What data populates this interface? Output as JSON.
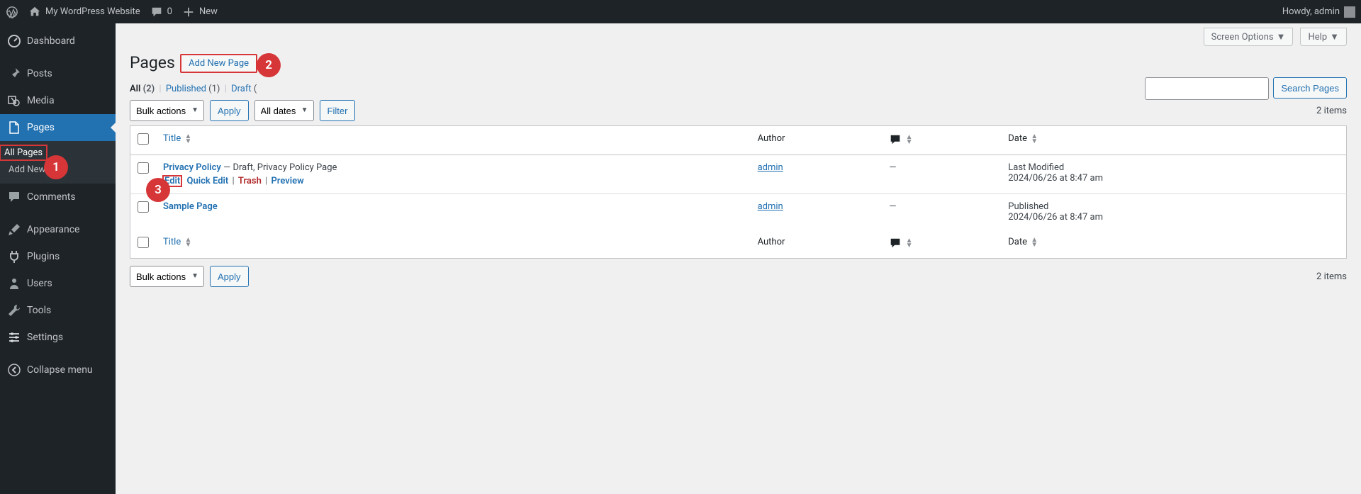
{
  "adminbar": {
    "site_name": "My WordPress Website",
    "comments_count": "0",
    "new_label": "New",
    "howdy": "Howdy, admin"
  },
  "sidebar": {
    "dashboard": "Dashboard",
    "posts": "Posts",
    "media": "Media",
    "pages": "Pages",
    "pages_sub_all": "All Pages",
    "pages_sub_add": "Add New",
    "comments": "Comments",
    "appearance": "Appearance",
    "plugins": "Plugins",
    "users": "Users",
    "tools": "Tools",
    "settings": "Settings",
    "collapse": "Collapse menu"
  },
  "screen_meta": {
    "screen_options": "Screen Options",
    "help": "Help"
  },
  "header": {
    "title": "Pages",
    "add_new": "Add New Page"
  },
  "filters": {
    "all_label": "All",
    "all_count": "(2)",
    "published_label": "Published",
    "published_count": "(1)",
    "draft_label": "Draft",
    "draft_count": "(",
    "bulk_actions": "Bulk actions",
    "apply": "Apply",
    "all_dates": "All dates",
    "filter": "Filter",
    "item_count": "2 items",
    "search_btn": "Search Pages"
  },
  "table": {
    "col_title": "Title",
    "col_author": "Author",
    "col_date": "Date",
    "rows": [
      {
        "title": "Privacy Policy",
        "state": " — Draft, Privacy Policy Page",
        "author": "admin",
        "comments": "—",
        "date_label": "Last Modified",
        "date_value": "2024/06/26 at 8:47 am",
        "actions": {
          "edit": "Edit",
          "quick": "Quick Edit",
          "trash": "Trash",
          "preview": "Preview"
        }
      },
      {
        "title": "Sample Page",
        "state": "",
        "author": "admin",
        "comments": "—",
        "date_label": "Published",
        "date_value": "2024/06/26 at 8:47 am"
      }
    ]
  },
  "annotations": {
    "a1": "1",
    "a2": "2",
    "a3": "3"
  }
}
